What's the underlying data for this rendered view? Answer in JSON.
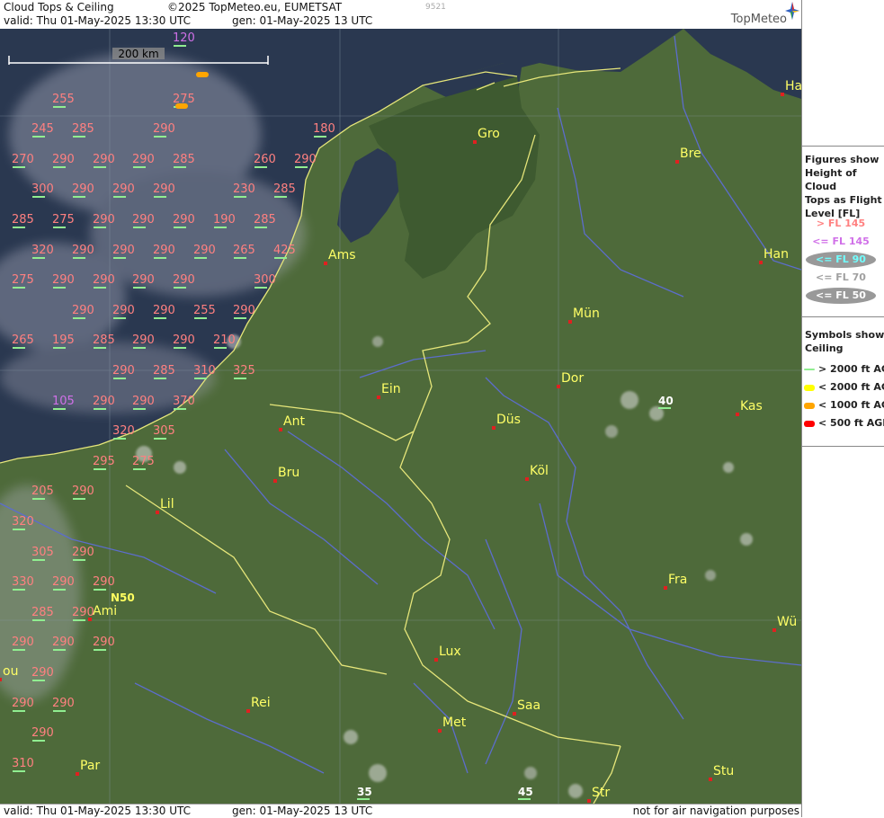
{
  "header": {
    "title": "Cloud Tops & Ceiling",
    "copyright": "©2025 TopMeteo.eu, EUMETSAT",
    "code": "9521",
    "valid": "valid:  Thu  01-May-2025  13:30 UTC",
    "gen": "gen: 01-May-2025 13 UTC",
    "brand": "TopMeteo"
  },
  "footer": {
    "valid": "valid:  Thu  01-May-2025  13:30 UTC",
    "gen": "gen: 01-May-2025 13 UTC",
    "disclaimer": "not for air navigation purposes"
  },
  "scale_label": "200 km",
  "lat_label": "N50",
  "legend": {
    "heading_figures": [
      "Figures show",
      "Height of Cloud",
      "Tops as Flight",
      "Level  [FL]"
    ],
    "fl_items": [
      {
        "label": "> FL 145",
        "color": "#ff8080",
        "bg": "none"
      },
      {
        "label": "<= FL 145",
        "color": "#d070e8",
        "bg": "none"
      },
      {
        "label": "<= FL 90",
        "color": "#70ffff",
        "bg": "#999999"
      },
      {
        "label": "<= FL 70",
        "color": "#a0a0a0",
        "bg": "none"
      },
      {
        "label": "<= FL 50",
        "color": "#ffffff",
        "bg": "#999999"
      }
    ],
    "heading_symbols": [
      "Symbols show",
      "Ceiling"
    ],
    "symbol_items": [
      {
        "label": "> 2000 ft AGL",
        "color": "#90ee90"
      },
      {
        "label": "< 2000 ft AGL",
        "color": "#ffff00"
      },
      {
        "label": "< 1000 ft AGL",
        "color": "#ffa500"
      },
      {
        "label": "< 500 ft AGL",
        "color": "#ff0000"
      }
    ]
  },
  "cities": [
    "Gro",
    "Bre",
    "Ha",
    "Ams",
    "Han",
    "Mün",
    "Dor",
    "Ein",
    "Ant",
    "Düs",
    "Kas",
    "Bru",
    "Köl",
    "Lil",
    "Fra",
    "Ami",
    "Lux",
    "Wü",
    "Rei",
    "Saa",
    "Met",
    "Par",
    "Stu",
    "Str",
    "ou"
  ],
  "cloud_tops": {
    "pink": [
      "255",
      "275",
      "245",
      "285",
      "290",
      "180",
      "270",
      "290",
      "290",
      "290",
      "285",
      "260",
      "290",
      "300",
      "290",
      "290",
      "290",
      "230",
      "285",
      "285",
      "275",
      "290",
      "290",
      "290",
      "190",
      "285",
      "320",
      "290",
      "290",
      "290",
      "290",
      "265",
      "425",
      "275",
      "290",
      "290",
      "290",
      "290",
      "300",
      "290",
      "290",
      "290",
      "255",
      "290",
      "265",
      "195",
      "285",
      "290",
      "290",
      "210",
      "290",
      "285",
      "310",
      "325",
      "290",
      "290",
      "370",
      "320",
      "305",
      "295",
      "275",
      "205",
      "290",
      "320",
      "305",
      "290",
      "330",
      "290",
      "290",
      "285",
      "290",
      "290",
      "290",
      "290",
      "290",
      "290",
      "290",
      "290",
      "310"
    ],
    "purple": [
      "120",
      "105"
    ],
    "white": [
      "40",
      "35",
      "45"
    ]
  },
  "ceiling_symbols": [
    "orange",
    "orange"
  ]
}
